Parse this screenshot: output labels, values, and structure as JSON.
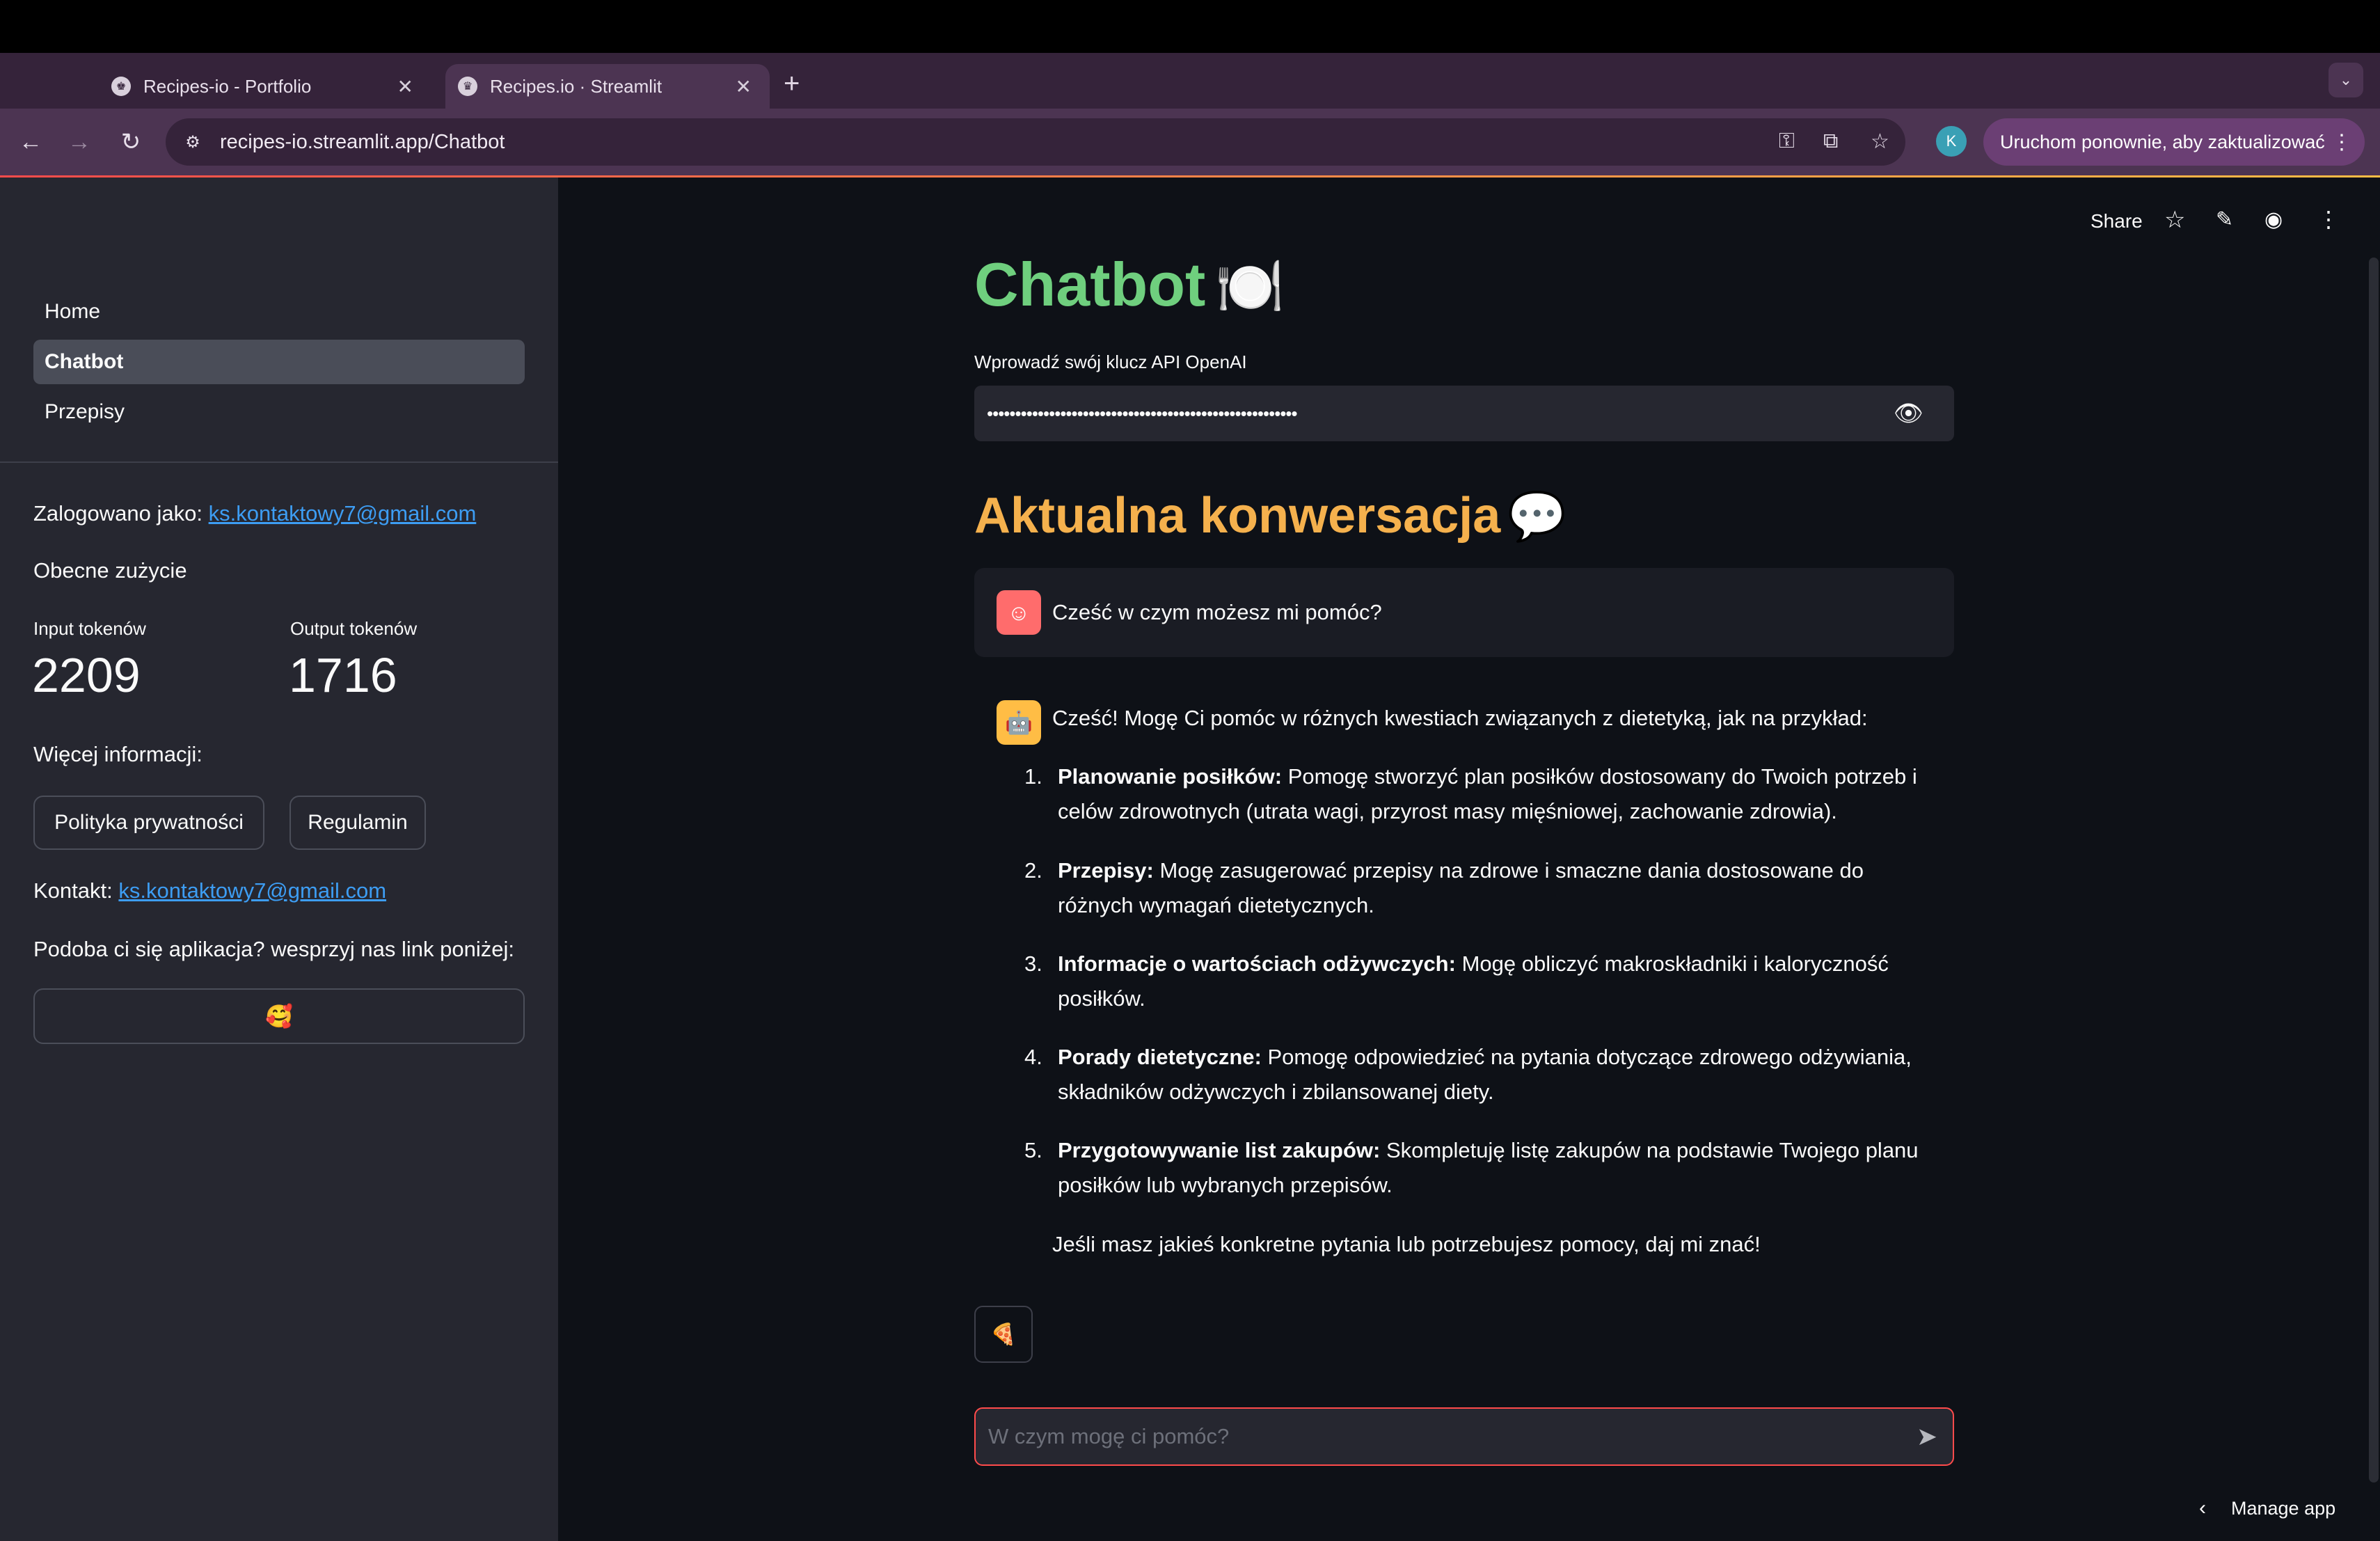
{
  "browser": {
    "tabs": [
      {
        "label": "Recipes-io - Portfolio",
        "active": false
      },
      {
        "label": "Recipes.io · Streamlit",
        "active": true
      }
    ],
    "url": "recipes-io.streamlit.app/Chatbot",
    "update_button": "Uruchom ponownie, aby zaktualizować",
    "profile_initial": "K"
  },
  "header": {
    "share_label": "Share"
  },
  "sidebar": {
    "nav": [
      {
        "label": "Home",
        "active": false
      },
      {
        "label": "Chatbot",
        "active": true
      },
      {
        "label": "Przepisy",
        "active": false
      }
    ],
    "logged_in_prefix": "Zalogowano jako:",
    "logged_in_email": "ks.kontaktowy7@gmail.com",
    "usage_heading": "Obecne zużycie",
    "input_tokens_label": "Input tokenów",
    "input_tokens_value": "2209",
    "output_tokens_label": "Output tokenów",
    "output_tokens_value": "1716",
    "more_info": "Więcej informacji:",
    "privacy_button": "Polityka prywatności",
    "terms_button": "Regulamin",
    "contact_prefix": "Kontakt:",
    "contact_email": "ks.kontaktowy7@gmail.com",
    "support_text": "Podoba ci się aplikacja? wesprzyj nas link poniżej:",
    "support_emoji": "🥰"
  },
  "main": {
    "title": "Chatbot",
    "title_emoji": "🍽️",
    "api_label": "Wprowadź swój klucz API OpenAI",
    "api_value_masked": "•••••••••••••••••••••••••••••••••••••••••••••••••••••••",
    "conversation_title": "Aktualna konwersacja",
    "conversation_emoji": "💬",
    "user_message": "Cześć w czym możesz mi pomóc?",
    "bot_intro": "Cześć! Mogę Ci pomóc w różnych kwestiach związanych z dietetyką, jak na przykład:",
    "bot_items": [
      {
        "num": "1.",
        "bold": "Planowanie posiłków:",
        "text": " Pomogę stworzyć plan posiłków dostosowany do Twoich potrzeb i celów zdrowotnych (utrata wagi, przyrost masy mięśniowej, zachowanie zdrowia)."
      },
      {
        "num": "2.",
        "bold": "Przepisy:",
        "text": " Mogę zasugerować przepisy na zdrowe i smaczne dania dostosowane do różnych wymagań dietetycznych."
      },
      {
        "num": "3.",
        "bold": "Informacje o wartościach odżywczych:",
        "text": " Mogę obliczyć makroskładniki i kaloryczność posiłków."
      },
      {
        "num": "4.",
        "bold": "Porady dietetyczne:",
        "text": " Pomogę odpowiedzieć na pytania dotyczące zdrowego odżywiania, składników odżywczych i zbilansowanej diety."
      },
      {
        "num": "5.",
        "bold": "Przygotowywanie list zakupów:",
        "text": " Skompletuję listę zakupów na podstawie Twojego planu posiłków lub wybranych przepisów."
      }
    ],
    "bot_outro": "Jeśli masz jakieś konkretne pytania lub potrzebujesz pomocy, daj mi znać!",
    "feedback_emoji": "🍕",
    "chat_placeholder": "W czym mogę ci pomóc?",
    "manage_app": "Manage app"
  },
  "colors": {
    "title_green": "#6fcf7e",
    "conversation_orange": "#f5b14d",
    "accent_red": "#ff4b4b",
    "link_blue": "#3d9df3"
  }
}
